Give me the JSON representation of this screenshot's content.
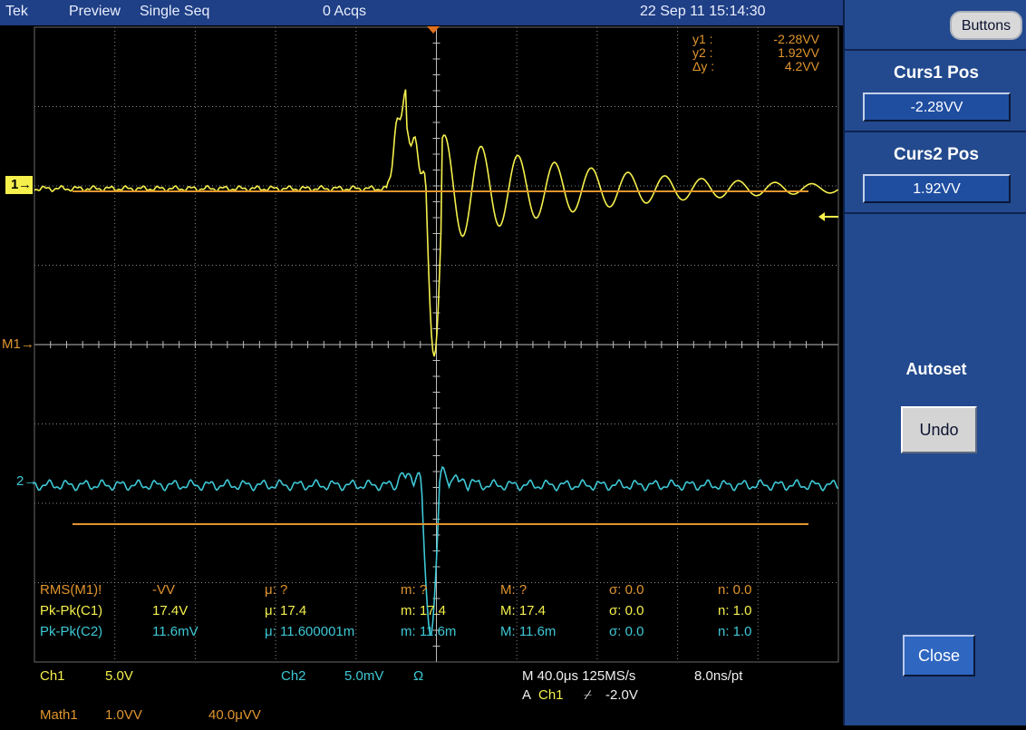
{
  "topbar": {
    "brand": "Tek",
    "mode": "Preview",
    "acq_mode": "Single Seq",
    "acqs": "0 Acqs",
    "datetime": "22 Sep 11 15:14:30"
  },
  "cursor_readout": {
    "y1_label": "y1 :",
    "y1_value": "-2.28VV",
    "y2_label": "y2 :",
    "y2_value": "1.92VV",
    "dy_label": "Δy :",
    "dy_value": "4.2VV"
  },
  "markers": {
    "ch1": "1",
    "math1": "M1",
    "ch2": "2"
  },
  "measurements": {
    "rows": [
      {
        "name": "RMS(M1)!",
        "value": "-VV",
        "mean": "μ: ?",
        "min": "m: ?",
        "max": "M: ?",
        "sigma": "σ: 0.0",
        "n": "n: 0.0"
      },
      {
        "name": "Pk-Pk(C1)",
        "value": "17.4V",
        "mean": "μ: 17.4",
        "min": "m: 17.4",
        "max": "M: 17.4",
        "sigma": "σ: 0.0",
        "n": "n: 1.0"
      },
      {
        "name": "Pk-Pk(C2)",
        "value": "11.6mV",
        "mean": "μ: 11.600001m",
        "min": "m: 11.6m",
        "max": "M: 11.6m",
        "sigma": "σ: 0.0",
        "n": "n: 1.0"
      }
    ]
  },
  "status": {
    "ch1_label": "Ch1",
    "ch1_scale": "5.0V",
    "ch2_label": "Ch2",
    "ch2_scale": "5.0mV",
    "ch2_term": "Ω",
    "horiz": "M 40.0μs 125MS/s",
    "res": "8.0ns/pt",
    "trigger_prefix": "A",
    "trigger_src": "Ch1",
    "trigger_slope": "⌿",
    "trigger_level": "-2.0V",
    "math1_label": "Math1",
    "math1_scale": "1.0VV",
    "math1_pos": "40.0μVV"
  },
  "panel": {
    "buttons_label": "Buttons",
    "curs1_title": "Curs1 Pos",
    "curs1_value": "-2.28VV",
    "curs2_title": "Curs2 Pos",
    "curs2_value": "1.92VV",
    "autoset_title": "Autoset",
    "undo_label": "Undo",
    "close_label": "Close"
  },
  "colors": {
    "ch1": "#f5f04c",
    "ch2": "#3ec8d6",
    "math": "#e0952e",
    "grid": "#8a8a8a",
    "panel": "#234a8e",
    "topbar": "#1f3f86"
  }
}
